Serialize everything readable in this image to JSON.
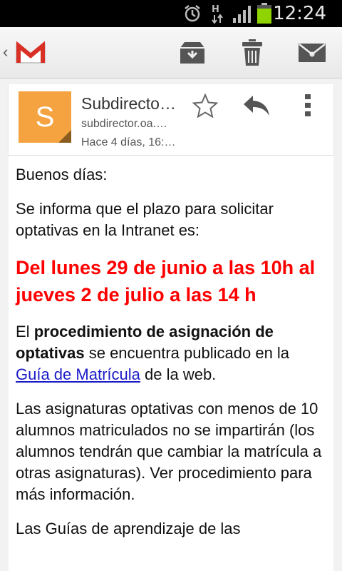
{
  "status_bar": {
    "time": "12:24",
    "network": "H"
  },
  "action_bar": {
    "app_icon": "gmail-logo-icon",
    "buttons": [
      {
        "name": "archive",
        "icon": "archive-icon"
      },
      {
        "name": "delete",
        "icon": "trash-icon"
      },
      {
        "name": "mark-unread",
        "icon": "envelope-icon"
      }
    ]
  },
  "message_header": {
    "avatar_letter": "S",
    "sender_name": "Subdirecto…",
    "sender_email": "subdirector.oa.…",
    "sent_time": "Hace 4 días, 16:…"
  },
  "message_body": {
    "greeting": "Buenos días:",
    "intro": "Se informa que el plazo para solicitar optativas en la Intranet es:",
    "deadline": "Del lunes 29 de junio a las 10h al jueves 2 de julio a las 14 h",
    "proc_prefix": "El",
    "proc_bold": "procedimiento de asignación de optativas",
    "proc_middle": "se encuentra publicado en la",
    "proc_link": "Guía de Matrícula",
    "proc_suffix": "de la web.",
    "paragraph_min": "Las asignaturas optativas con menos de 10 alumnos matriculados no se impartirán (los alumnos tendrán que cambiar la matrícula a otras asignaturas). Ver procedimiento para más información.",
    "cut_line": "Las Guías de aprendizaje de las"
  },
  "colors": {
    "accent": "#ff0000",
    "avatar": "#f4a340",
    "link": "#1a1ac8",
    "battery": "#8fd400"
  }
}
